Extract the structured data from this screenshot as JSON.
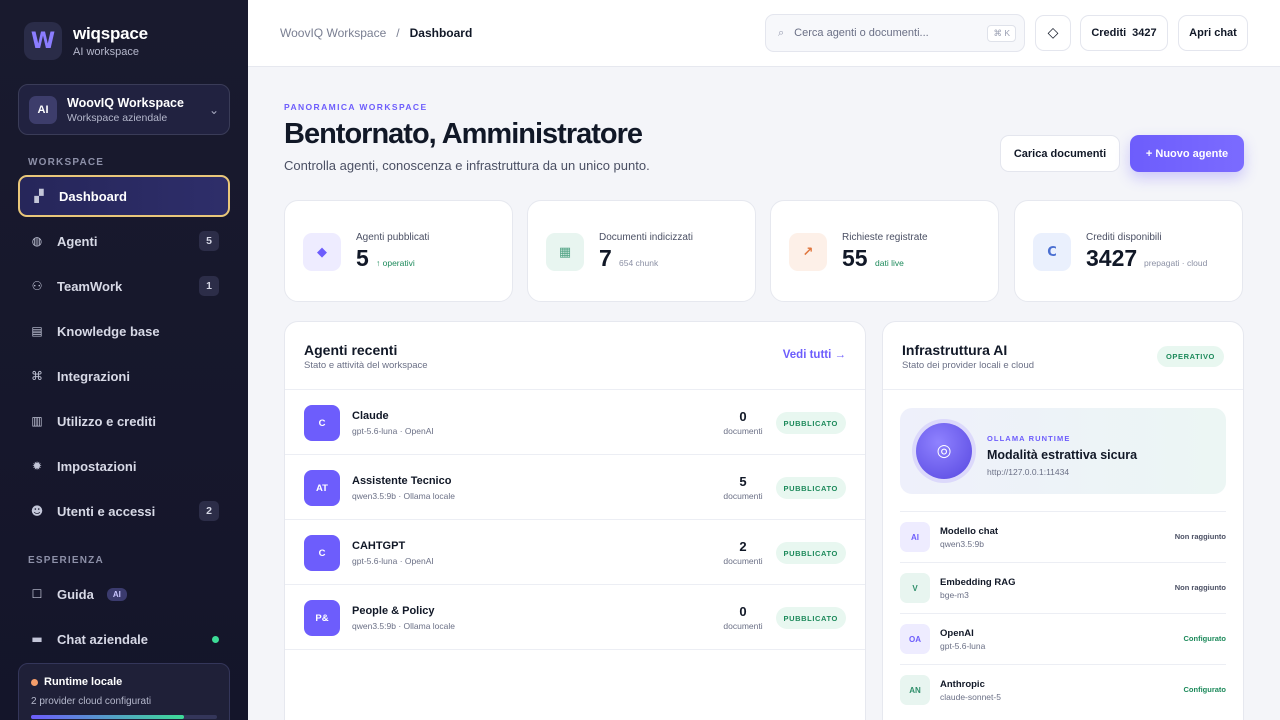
{
  "brand": {
    "logo_letter": "W",
    "name": "wiqspace",
    "subtitle": "AI workspace"
  },
  "workspace": {
    "avatar": "AI",
    "name": "WoovIQ Workspace",
    "type": "Workspace aziendale"
  },
  "sidebar": {
    "section_workspace": "WORKSPACE",
    "section_experience": "ESPERIENZA",
    "items": [
      {
        "label": "Dashboard",
        "icon": "dashboard-icon",
        "glyph": "▞",
        "badge": ""
      },
      {
        "label": "Agenti",
        "icon": "robot-icon",
        "glyph": "◍",
        "badge": "5"
      },
      {
        "label": "TeamWork",
        "icon": "team-icon",
        "glyph": "⚇",
        "badge": "1"
      },
      {
        "label": "Knowledge base",
        "icon": "document-icon",
        "glyph": "▤",
        "badge": ""
      },
      {
        "label": "Integrazioni",
        "icon": "integration-icon",
        "glyph": "⌘",
        "badge": ""
      },
      {
        "label": "Utilizzo e crediti",
        "icon": "chart-icon",
        "glyph": "▥",
        "badge": ""
      },
      {
        "label": "Impostazioni",
        "icon": "gear-icon",
        "glyph": "✹",
        "badge": ""
      },
      {
        "label": "Utenti e accessi",
        "icon": "users-icon",
        "glyph": "☻",
        "badge": "2"
      }
    ],
    "experience_items": [
      {
        "label": "Guida",
        "icon": "book-icon",
        "glyph": "☐",
        "pill": "AI"
      },
      {
        "label": "Chat aziendale",
        "icon": "chat-icon",
        "glyph": "▬"
      }
    ],
    "runtime": {
      "title": "Runtime locale",
      "subtitle": "2 provider cloud configurati"
    }
  },
  "topbar": {
    "breadcrumb_root": "WoovIQ Workspace",
    "breadcrumb_sep": "/",
    "breadcrumb_current": "Dashboard",
    "search_placeholder": "Cerca agenti o documenti...",
    "search_shortcut": "⌘ K",
    "theme_glyph": "◇",
    "credits_label": "Crediti",
    "credits_value": "3427",
    "open_chat": "Apri chat"
  },
  "header": {
    "eyebrow": "PANORAMICA WORKSPACE",
    "title": "Bentornato, Amministratore",
    "subtitle": "Controlla agenti, conoscenza e infrastruttura da un unico punto.",
    "upload_button": "Carica documenti",
    "new_agent_button": "+ Nuovo agente"
  },
  "stats": [
    {
      "label": "Agenti pubblicati",
      "value": "5",
      "note": "↑ operativi",
      "note_color": "#1d8a5b",
      "icon": "diamond-icon",
      "glyph": "◆",
      "icon_bg": "#eeecff",
      "icon_fg": "#6d5dfc"
    },
    {
      "label": "Documenti indicizzati",
      "value": "7",
      "note": "654 chunk",
      "note_color": "#8b90a4",
      "icon": "database-icon",
      "glyph": "▦",
      "icon_bg": "#e8f5f0",
      "icon_fg": "#4fa283"
    },
    {
      "label": "Richieste registrate",
      "value": "55",
      "note": "dati live",
      "note_color": "#1d8a5b",
      "icon": "arrow-up-right-icon",
      "glyph": "↗",
      "icon_bg": "#fdf0e8",
      "icon_fg": "#e0773f"
    },
    {
      "label": "Crediti disponibili",
      "value": "3427",
      "note": "prepagati · cloud",
      "note_color": "#8b90a4",
      "icon": "credit-icon",
      "glyph": "C",
      "icon_bg": "#eaf0fd",
      "icon_fg": "#4a6fd1"
    }
  ],
  "recent_agents": {
    "title": "Agenti recenti",
    "subtitle": "Stato e attività del workspace",
    "link": "Vedi tutti →",
    "count_label": "documenti",
    "rows": [
      {
        "avatar": "C",
        "name": "Claude",
        "model": "gpt-5.6-luna · OpenAI",
        "count": "0",
        "status": "PUBBLICATO"
      },
      {
        "avatar": "AT",
        "name": "Assistente Tecnico",
        "model": "qwen3.5:9b · Ollama locale",
        "count": "5",
        "status": "PUBBLICATO"
      },
      {
        "avatar": "C",
        "name": "CAHTGPT",
        "model": "gpt-5.6-luna · OpenAI",
        "count": "2",
        "status": "PUBBLICATO"
      },
      {
        "avatar": "P&",
        "name": "People & Policy",
        "model": "qwen3.5:9b · Ollama locale",
        "count": "0",
        "status": "PUBBLICATO"
      }
    ]
  },
  "infra": {
    "title": "Infrastruttura AI",
    "subtitle": "Stato dei provider locali e cloud",
    "badge": "OPERATIVO",
    "runtime": {
      "eyebrow": "OLLAMA RUNTIME",
      "title": "Modalità estrattiva sicura",
      "url": "http://127.0.0.1:11434",
      "glyph": "◎"
    },
    "providers": [
      {
        "avatar": "AI",
        "name": "Modello chat",
        "model": "qwen3.5:9b",
        "status": "Non raggiunto",
        "status_color": "#4b5064",
        "av_bg": "#eeecff",
        "av_fg": "#6d5dfc"
      },
      {
        "avatar": "V",
        "name": "Embedding RAG",
        "model": "bge-m3",
        "status": "Non raggiunto",
        "status_color": "#4b5064",
        "av_bg": "#e8f5f0",
        "av_fg": "#2f8f6b"
      },
      {
        "avatar": "OA",
        "name": "OpenAI",
        "model": "gpt-5.6-luna",
        "status": "Configurato",
        "status_color": "#1d8a5b",
        "av_bg": "#eeecff",
        "av_fg": "#6d5dfc"
      },
      {
        "avatar": "AN",
        "name": "Anthropic",
        "model": "claude-sonnet-5",
        "status": "Configurato",
        "status_color": "#1d8a5b",
        "av_bg": "#e8f5f0",
        "av_fg": "#2f8f6b"
      }
    ]
  }
}
